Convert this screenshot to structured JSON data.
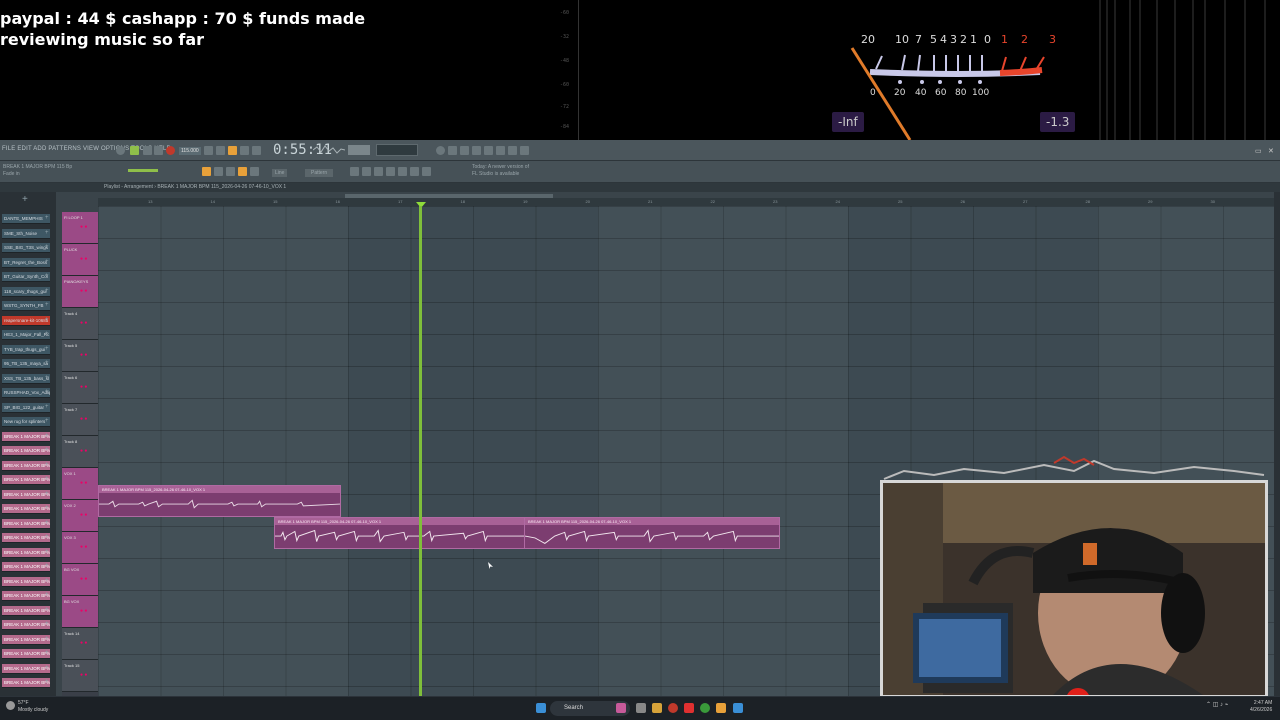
{
  "overlay": {
    "donation_line1": "paypal : 44 $  cashapp : 70 $ funds made",
    "donation_line2": "reviewing music so far",
    "scope_ticks": [
      "-60",
      "-32",
      "-48",
      "-60",
      "-72",
      "-84"
    ]
  },
  "vu_meter": {
    "scale_top": [
      "20",
      "10",
      "7",
      "5",
      "4",
      "3",
      "2",
      "1",
      "0"
    ],
    "scale_top_red": [
      "1",
      "2",
      "3"
    ],
    "scale_bottom": [
      "0",
      "20",
      "40",
      "60",
      "80",
      "100"
    ],
    "left_readout": "-Inf",
    "right_readout": "-1.3",
    "colors": {
      "needle": "#e07b2a",
      "red_zone": "#e8452c",
      "scale": "#c8c8e8"
    }
  },
  "daw": {
    "menu": "FILE EDIT ADD PATTERNS VIEW OPTIONS TOOLS HELP",
    "tempo": "115.000",
    "time": "0:55:11",
    "hint_line1": "BREAK 1 MAJOR BPM 115 Bp",
    "hint_line2": "Fade in",
    "snap": "Line",
    "pattern": "Pattern",
    "news_line1": "Today: A newer version of",
    "news_line2": "FL Studio is available",
    "playlist_title": "Playlist - Arrangement › BREAK 1 MAJOR BPM 115_2026-04-26 07-46-10_VOX 1",
    "ruler": [
      "13",
      "14",
      "15",
      "16",
      "17",
      "18",
      "19",
      "20",
      "21",
      "22",
      "23",
      "24",
      "25",
      "26",
      "27",
      "28",
      "29",
      "30"
    ],
    "browser_items": [
      {
        "label": "DANTE_MEMPHIS",
        "style": "blue"
      },
      {
        "label": "SME_Sth_Noise",
        "style": "blue"
      },
      {
        "label": "SSE_BIG_T3S_wings",
        "style": "blue"
      },
      {
        "label": "BT_Regret_the_Boss",
        "style": "blue"
      },
      {
        "label": "BT_Guitar_Synth_Col",
        "style": "blue"
      },
      {
        "label": "118_scary_thugs_gui",
        "style": "blue"
      },
      {
        "label": "WSTG_SYNTH_FB",
        "style": "blue"
      },
      {
        "label": "reapersnare-kit-10685",
        "style": "red"
      },
      {
        "label": "HE3_1_Major_Fall_Rc",
        "style": "blue"
      },
      {
        "label": "TYB_trap_thugs_gui",
        "style": "blue"
      },
      {
        "label": "95_TB_135_maya_sa",
        "style": "blue"
      },
      {
        "label": "XSS_TB_135_bass_sl",
        "style": "blue"
      },
      {
        "label": "RUSSPHAD_Vox_Adlip",
        "style": "blue"
      },
      {
        "label": "SP_BIG_122_guitar",
        "style": "blue"
      },
      {
        "label": "New rug for splinters",
        "style": "blue"
      },
      {
        "label": "BREAK 1 MAJOR BPM 115",
        "style": "pink"
      },
      {
        "label": "BREAK 1 MAJOR BPM 115",
        "style": "pink"
      },
      {
        "label": "BREAK 1 MAJOR BPM 115",
        "style": "pink"
      },
      {
        "label": "BREAK 1 MAJOR BPM 115",
        "style": "pink"
      },
      {
        "label": "BREAK 1 MAJOR BPM 115",
        "style": "pink"
      },
      {
        "label": "BREAK 1 MAJOR BPM 115",
        "style": "pink"
      },
      {
        "label": "BREAK 1 MAJOR BPM 115",
        "style": "pink"
      },
      {
        "label": "BREAK 1 MAJOR BPM 115",
        "style": "pink"
      },
      {
        "label": "BREAK 1 MAJOR BPM 115",
        "style": "pink"
      },
      {
        "label": "BREAK 1 MAJOR BPM 115",
        "style": "pink"
      },
      {
        "label": "BREAK 1 MAJOR BPM 115",
        "style": "pink"
      },
      {
        "label": "BREAK 1 MAJOR BPM 115",
        "style": "pink"
      },
      {
        "label": "BREAK 1 MAJOR BPM 115",
        "style": "pink"
      },
      {
        "label": "BREAK 1 MAJOR BPM 115",
        "style": "pink"
      },
      {
        "label": "BREAK 1 MAJOR BPM 115",
        "style": "pink"
      },
      {
        "label": "BREAK 1 MAJOR BPM 115",
        "style": "pink"
      },
      {
        "label": "BREAK 1 MAJOR BPM 115",
        "style": "pink"
      },
      {
        "label": "BREAK 1 MAJOR BPM 115",
        "style": "pink"
      }
    ],
    "tracks": [
      {
        "name": "Fl LOOP 1",
        "style": "pink"
      },
      {
        "name": "PLUCK",
        "style": "pink"
      },
      {
        "name": "PIANO/KEYS",
        "style": "pink"
      },
      {
        "name": "Track 4",
        "style": "grey"
      },
      {
        "name": "Track 5",
        "style": "grey"
      },
      {
        "name": "Track 6",
        "style": "grey"
      },
      {
        "name": "Track 7",
        "style": "grey"
      },
      {
        "name": "Track 8",
        "style": "grey"
      },
      {
        "name": "VOX 1",
        "style": "pink"
      },
      {
        "name": "VOX 2",
        "style": "pink"
      },
      {
        "name": "VOX 3",
        "style": "pink"
      },
      {
        "name": "BG VOX",
        "style": "pink"
      },
      {
        "name": "BG VOX",
        "style": "pink"
      },
      {
        "name": "Track 14",
        "style": "grey"
      },
      {
        "name": "Track 15",
        "style": "grey"
      }
    ],
    "clips": [
      {
        "label": "BREAK 1 MAJOR BPM 115_2026-04-26 07-46-10_VOX 1",
        "bar": "clip1"
      },
      {
        "label": "BREAK 1 MAJOR BPM 115_2026-04-26 07-46-10_VOX 1",
        "bar": "clip2"
      },
      {
        "label": "BREAK 1 MAJOR BPM 115_2026-04-26 07-46-10_VOX 1",
        "bar": "clip3"
      }
    ]
  },
  "taskbar": {
    "weather_temp": "57°F",
    "weather_text": "Mostly cloudy",
    "search": "Search",
    "clock_time": "2:47 AM",
    "clock_date": "4/26/2026"
  }
}
